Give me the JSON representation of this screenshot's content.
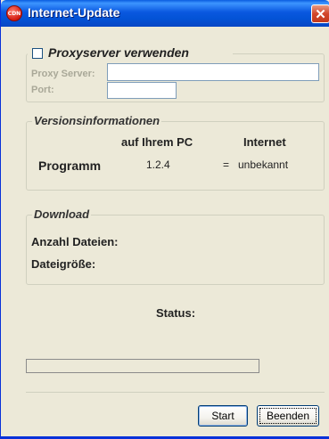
{
  "window": {
    "title": "Internet-Update",
    "icon_text": "CDN"
  },
  "proxy": {
    "checkbox_label": "Proxyserver verwenden",
    "checked": false,
    "server_label": "Proxy Server:",
    "server_value": "",
    "port_label": "Port:",
    "port_value": ""
  },
  "version": {
    "group_label": "Versionsinformationen",
    "col_local": "auf Ihrem PC",
    "col_internet": "Internet",
    "row_label": "Programm",
    "local_value": "1.2.4",
    "comparison": "=",
    "internet_value": "unbekannt"
  },
  "download": {
    "group_label": "Download",
    "file_count_label": "Anzahl Dateien:",
    "file_size_label": "Dateigröße:"
  },
  "status": {
    "label": "Status:",
    "progress": 0
  },
  "buttons": {
    "start": "Start",
    "quit": "Beenden"
  }
}
